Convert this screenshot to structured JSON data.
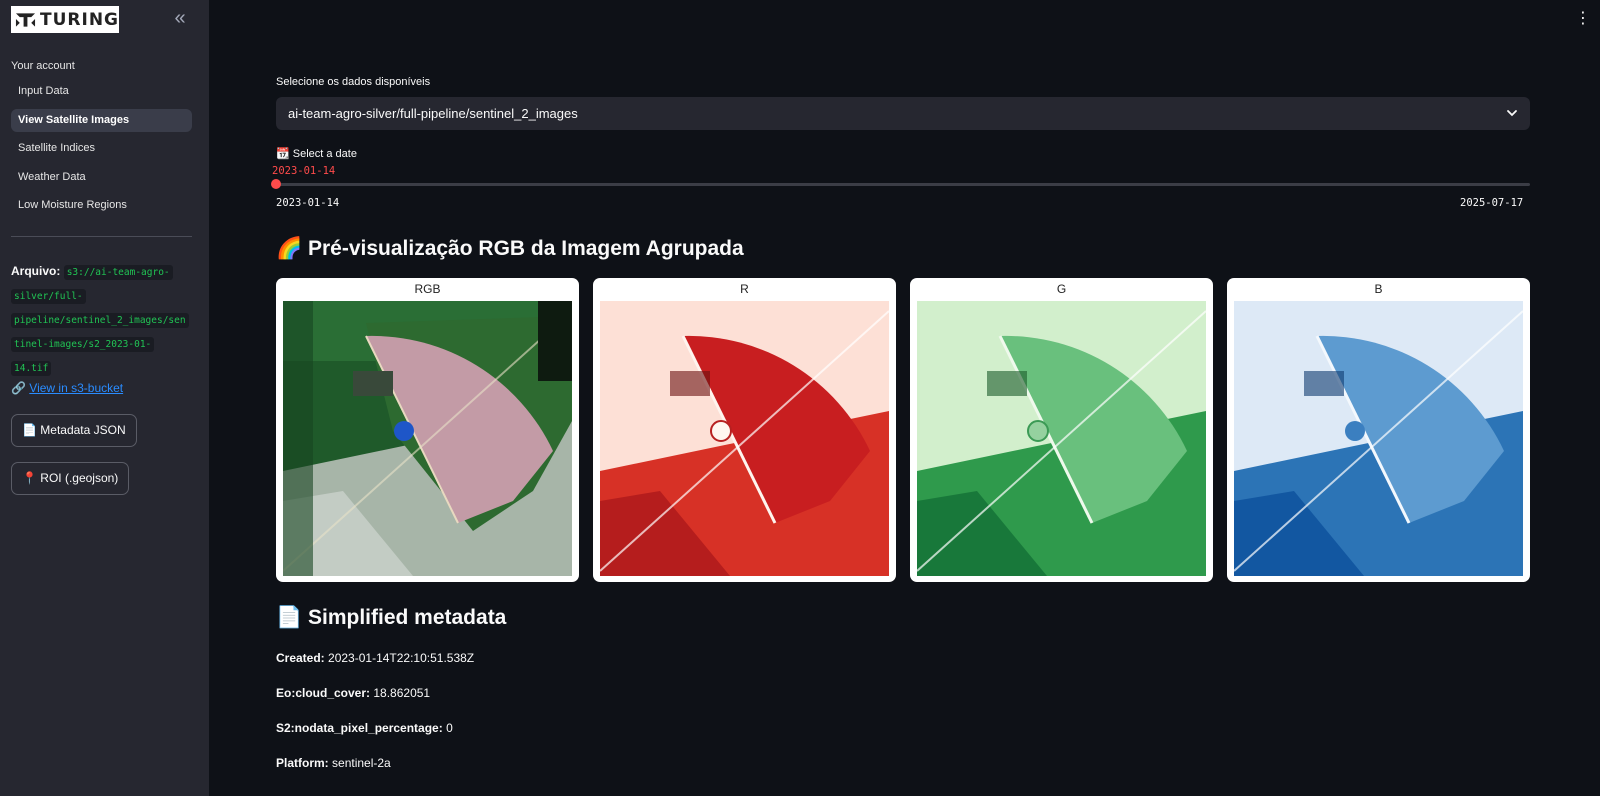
{
  "sidebar": {
    "logo_text": "TURING",
    "nav_header": "Your account",
    "items": [
      {
        "label": "Input Data"
      },
      {
        "label": "View Satellite Images"
      },
      {
        "label": "Satellite Indices"
      },
      {
        "label": "Weather Data"
      },
      {
        "label": "Low Moisture Regions"
      }
    ],
    "arquivo_label": "Arquivo:",
    "arquivo_path_lines": [
      "s3://ai-team-agro-",
      "silver/full-",
      "pipeline/sentinel_2_images/sen",
      "tinel-images/s2_2023-01-",
      "14.tif"
    ],
    "link_icon": "🔗",
    "link_text": "View in s3-bucket",
    "metadata_button": "📄 Metadata JSON",
    "roi_button": "📍 ROI (.geojson)"
  },
  "main": {
    "select_label": "Selecione os dados disponíveis",
    "select_value": "ai-team-agro-silver/full-pipeline/sentinel_2_images",
    "date_label": "📆 Select a date",
    "slider_value": "2023-01-14",
    "slider_min": "2023-01-14",
    "slider_max": "2025-07-17",
    "slider_position": 0,
    "preview_title": "🌈 Pré-visualização RGB da Imagem Agrupada",
    "preview_cards": [
      {
        "title": "RGB"
      },
      {
        "title": "R"
      },
      {
        "title": "G"
      },
      {
        "title": "B"
      }
    ],
    "metadata_title": "📄 Simplified metadata",
    "metadata": [
      {
        "key": "Created:",
        "value": "2023-01-14T22:10:51.538Z"
      },
      {
        "key": "Eo:cloud_cover:",
        "value": "18.862051"
      },
      {
        "key": "S2:nodata_pixel_percentage:",
        "value": "0"
      },
      {
        "key": "Platform:",
        "value": "sentinel-2a"
      }
    ]
  },
  "colors": {
    "accent": "#ff4b4b",
    "background": "#0e1117",
    "sidebar": "#262730",
    "code_text": "#21c354",
    "link": "#2a8cff"
  }
}
